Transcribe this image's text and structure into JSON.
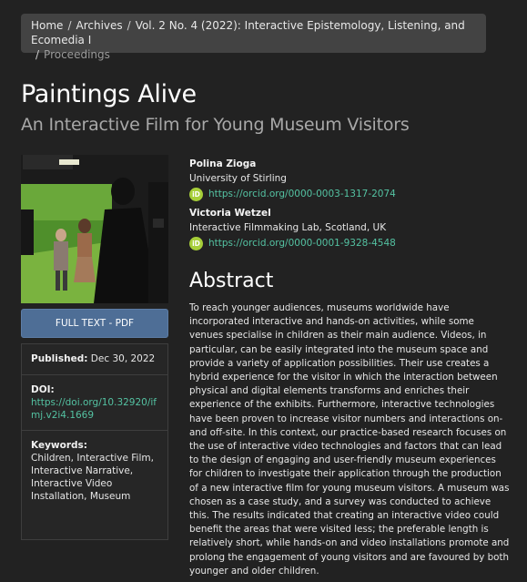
{
  "breadcrumb": {
    "items": [
      "Home",
      "Archives",
      "Vol. 2 No. 4 (2022): Interactive Epistemology, Listening, and Ecomedia I"
    ],
    "current": "Proceedings",
    "separator": "/"
  },
  "article": {
    "title": "Paintings Alive",
    "subtitle": "An Interactive Film for Young Museum Visitors"
  },
  "authors": [
    {
      "name": "Polina Zioga",
      "affiliation": "University of Stirling",
      "orcid": "https://orcid.org/0000-0003-1317-2074"
    },
    {
      "name": "Victoria Wetzel",
      "affiliation": "Interactive Filmmaking Lab, Scotland, UK",
      "orcid": "https://orcid.org/0000-0001-9328-4548"
    }
  ],
  "orcid_icon_text": "iD",
  "sidebar": {
    "pdf_button": "FULL TEXT - PDF",
    "published_label": "Published:",
    "published_value": "Dec 30, 2022",
    "doi_label": "DOI:",
    "doi_value": "https://doi.org/10.32920/ifmj.v2i4.1669",
    "keywords_label": "Keywords:",
    "keywords_value": "Children, Interactive Film, Interactive Narrative, Interactive Video Installation, Museum"
  },
  "abstract": {
    "heading": "Abstract",
    "text": "To reach younger audiences, museums worldwide have incorporated interactive and hands-on activities, while some venues specialise in children as their main audience. Videos, in particular, can be easily integrated into the museum space and provide a variety of application possibilities. Their use creates a hybrid experience for the visitor in which the interaction between physical and digital elements transforms and enriches their experience of the exhibits. Furthermore, interactive technologies have been proven to increase visitor numbers and interactions on- and off-site. In this context, our practice-based research focuses on the use of interactive video technologies and factors that can lead to the design of engaging and user-friendly museum experiences for children to investigate their application through the production of a new interactive film for young museum visitors. A museum was chosen as a case study, and a survey was conducted to achieve this. The results indicated that creating an interactive video could benefit the areas that were visited less; the preferable length is relatively short, while hands-on and video installations promote and prolong the engagement of young visitors and are favoured by both younger and older children."
  },
  "colors": {
    "background": "#222222",
    "link": "#54c2a2",
    "button": "#4e6e96",
    "orcid": "#a6ce39"
  }
}
